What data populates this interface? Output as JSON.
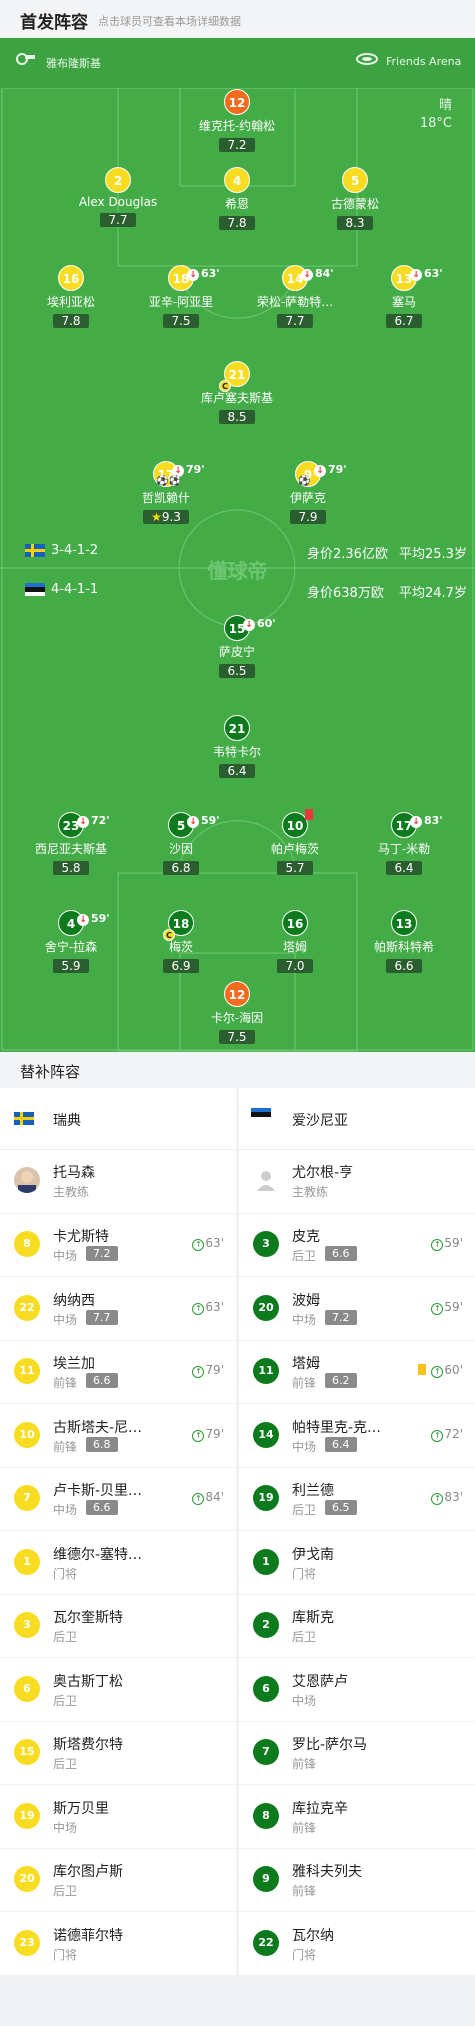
{
  "header": {
    "title": "首发阵容",
    "subtitle": "点击球员可查看本场详细数据"
  },
  "venue": {
    "coach_area": "雅布隆斯基",
    "stadium": "Friends Arena",
    "weather": "晴",
    "temperature": "18°C"
  },
  "watermark": "懂球帝",
  "home": {
    "name": "瑞典",
    "formation": "3-4-1-2",
    "value": "身价2.36亿欧",
    "avg_age": "平均25.3岁",
    "players": [
      {
        "num": "12",
        "name": "维克托-约翰松",
        "rating": "7.2"
      },
      {
        "num": "2",
        "name": "Alex Douglas",
        "rating": "7.7"
      },
      {
        "num": "4",
        "name": "希恩",
        "rating": "7.8"
      },
      {
        "num": "5",
        "name": "古德蒙松",
        "rating": "8.3"
      },
      {
        "num": "16",
        "name": "埃利亚松",
        "rating": "7.8"
      },
      {
        "num": "18",
        "name": "亚辛-阿亚里",
        "rating": "7.5",
        "sub": "63'"
      },
      {
        "num": "14",
        "name": "荣松-萨勒特…",
        "rating": "7.7",
        "sub": "84'"
      },
      {
        "num": "13",
        "name": "塞马",
        "rating": "6.7",
        "sub": "63'"
      },
      {
        "num": "21",
        "name": "库卢塞夫斯基",
        "rating": "8.5"
      },
      {
        "num": "17",
        "name": "哲凯赖什",
        "rating": "9.3",
        "sub": "79'"
      },
      {
        "num": "9",
        "name": "伊萨克",
        "rating": "7.9",
        "sub": "79'"
      }
    ]
  },
  "away": {
    "name": "爱沙尼亚",
    "formation": "4-4-1-1",
    "value": "身价638万欧",
    "avg_age": "平均24.7岁",
    "players": [
      {
        "num": "15",
        "name": "萨皮宁",
        "rating": "6.5",
        "sub": "60'"
      },
      {
        "num": "21",
        "name": "韦特卡尔",
        "rating": "6.4"
      },
      {
        "num": "23",
        "name": "西尼亚夫斯基",
        "rating": "5.8",
        "sub": "72'"
      },
      {
        "num": "5",
        "name": "沙因",
        "rating": "6.8",
        "sub": "59'"
      },
      {
        "num": "10",
        "name": "帕卢梅茨",
        "rating": "5.7"
      },
      {
        "num": "17",
        "name": "马丁-米勒",
        "rating": "6.4",
        "sub": "83'"
      },
      {
        "num": "4",
        "name": "舍宁-拉森",
        "rating": "5.9",
        "sub": "59'"
      },
      {
        "num": "18",
        "name": "梅茨",
        "rating": "6.9"
      },
      {
        "num": "16",
        "name": "塔姆",
        "rating": "7.0"
      },
      {
        "num": "13",
        "name": "帕斯科特希",
        "rating": "6.6"
      },
      {
        "num": "12",
        "name": "卡尔-海因",
        "rating": "7.5"
      }
    ]
  },
  "subs": {
    "title": "替补阵容",
    "home": {
      "team": "瑞典",
      "coach": {
        "name": "托马森",
        "role": "主教练"
      },
      "players": [
        {
          "num": "8",
          "name": "卡尤斯特",
          "pos": "中场",
          "rating": "7.2",
          "min": "63'"
        },
        {
          "num": "22",
          "name": "纳纳西",
          "pos": "中场",
          "rating": "7.7",
          "min": "63'"
        },
        {
          "num": "11",
          "name": "埃兰加",
          "pos": "前锋",
          "rating": "6.6",
          "min": "79'"
        },
        {
          "num": "10",
          "name": "古斯塔夫-尼…",
          "pos": "前锋",
          "rating": "6.8",
          "min": "79'"
        },
        {
          "num": "7",
          "name": "卢卡斯-贝里…",
          "pos": "中场",
          "rating": "6.6",
          "min": "84'"
        },
        {
          "num": "1",
          "name": "维德尔-塞特…",
          "pos": "门将"
        },
        {
          "num": "3",
          "name": "瓦尔奎斯特",
          "pos": "后卫"
        },
        {
          "num": "6",
          "name": "奥古斯丁松",
          "pos": "后卫"
        },
        {
          "num": "15",
          "name": "斯塔费尔特",
          "pos": "后卫"
        },
        {
          "num": "19",
          "name": "斯万贝里",
          "pos": "中场"
        },
        {
          "num": "20",
          "name": "库尔图卢斯",
          "pos": "后卫"
        },
        {
          "num": "23",
          "name": "诺德菲尔特",
          "pos": "门将"
        }
      ]
    },
    "away": {
      "team": "爱沙尼亚",
      "coach": {
        "name": "尤尔根-亨",
        "role": "主教练"
      },
      "players": [
        {
          "num": "3",
          "name": "皮克",
          "pos": "后卫",
          "rating": "6.6",
          "min": "59'"
        },
        {
          "num": "20",
          "name": "波姆",
          "pos": "中场",
          "rating": "7.2",
          "min": "59'"
        },
        {
          "num": "11",
          "name": "塔姆",
          "pos": "前锋",
          "rating": "6.2",
          "min": "60'",
          "card": "yellow"
        },
        {
          "num": "14",
          "name": "帕特里克-克…",
          "pos": "中场",
          "rating": "6.4",
          "min": "72'"
        },
        {
          "num": "19",
          "name": "利兰德",
          "pos": "后卫",
          "rating": "6.5",
          "min": "83'"
        },
        {
          "num": "1",
          "name": "伊戈南",
          "pos": "门将"
        },
        {
          "num": "2",
          "name": "库斯克",
          "pos": "后卫"
        },
        {
          "num": "6",
          "name": "艾恩萨卢",
          "pos": "中场"
        },
        {
          "num": "7",
          "name": "罗比-萨尔马",
          "pos": "前锋"
        },
        {
          "num": "8",
          "name": "库拉克辛",
          "pos": "前锋"
        },
        {
          "num": "9",
          "name": "雅科夫列夫",
          "pos": "前锋"
        },
        {
          "num": "22",
          "name": "瓦尔纳",
          "pos": "门将"
        }
      ]
    }
  },
  "colors": {
    "pitch": "#43ac47",
    "home_shirt": "#f7dc21",
    "away_shirt": "#0d7a1d",
    "keeper": "#f26b1e"
  }
}
